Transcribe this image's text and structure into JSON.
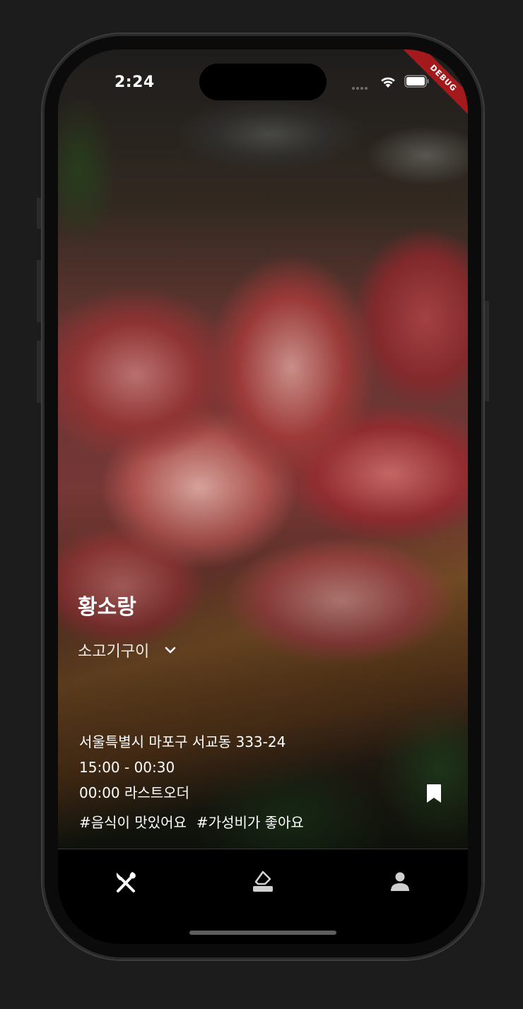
{
  "status_bar": {
    "time": "2:24",
    "debug_label": "DEBUG",
    "wifi_icon": "wifi-icon",
    "battery_icon": "battery-icon"
  },
  "restaurant": {
    "name": "황소랑",
    "category": "소고기구이",
    "address": "서울특별시 마포구 서교동 333-24",
    "hours": "15:00 - 00:30",
    "last_order": "00:00 라스트오더",
    "tags": [
      "#음식이 맛있어요",
      "#가성비가 좋아요"
    ],
    "photo_description_icon": "food-photo"
  },
  "actions": {
    "bookmark_icon": "bookmark-icon",
    "category_dropdown_icon": "chevron-down-icon"
  },
  "bottom_nav": {
    "items": [
      {
        "icon": "fork-spoon-icon",
        "selected": true
      },
      {
        "icon": "edit-icon",
        "selected": false
      },
      {
        "icon": "person-icon",
        "selected": false
      }
    ]
  },
  "colors": {
    "background": "#1c1c1c",
    "nav_background": "#000000",
    "text": "#ffffff",
    "debug_ribbon": "#a3191c"
  }
}
